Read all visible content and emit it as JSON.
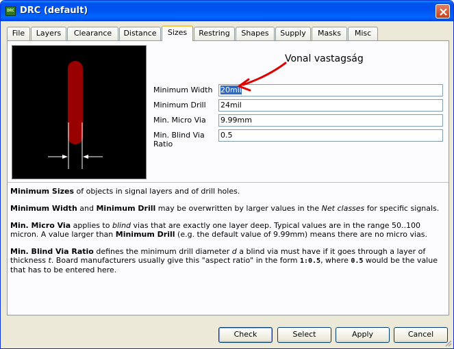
{
  "window": {
    "title": "DRC (default)",
    "app_icon_text": "DRC"
  },
  "tabs": [
    {
      "label": "File"
    },
    {
      "label": "Layers"
    },
    {
      "label": "Clearance"
    },
    {
      "label": "Distance"
    },
    {
      "label": "Sizes"
    },
    {
      "label": "Restring"
    },
    {
      "label": "Shapes"
    },
    {
      "label": "Supply"
    },
    {
      "label": "Masks"
    },
    {
      "label": "Misc"
    }
  ],
  "active_tab": "Sizes",
  "annotation": "Vonal vastagság",
  "fields": [
    {
      "label": "Minimum Width",
      "value": "20mil"
    },
    {
      "label": "Minimum Drill",
      "value": "24mil"
    },
    {
      "label": "Min. Micro Via",
      "value": "9.99mm"
    },
    {
      "label": "Min. Blind Via Ratio",
      "value": "0.5"
    }
  ],
  "help": {
    "p1": {
      "b1": "Minimum Sizes",
      "t1": " of objects in signal layers and of drill holes."
    },
    "p2": {
      "b1": "Minimum Width",
      "t1": " and ",
      "b2": "Minimum Drill",
      "t2": " may be overwritten by larger values in the ",
      "i1": "Net classes",
      "t3": " for specific signals."
    },
    "p3": {
      "b1": "Min. Micro Via",
      "t1": " applies to ",
      "i1": "blind",
      "t2": " vias that are exactly one layer deep. Typical values are in the range 50..100 micron. A value larger than ",
      "b2": "Minimum Drill",
      "t3": " (e.g. the default value of 9.99mm) means there are no micro vias."
    },
    "p4": {
      "b1": "Min. Blind Via Ratio",
      "t1": " defines the minimum drill diameter ",
      "i1": "d",
      "t2": " a blind via must have if it goes through a layer of thickness ",
      "i2": "t",
      "t3": ". Board manufacturers usually give this \"aspect ratio\" in the form ",
      "m1": "1:0.5",
      "t4": ", where ",
      "m2": "0.5",
      "t5": " would be the value that has to be entered here."
    }
  },
  "buttons": {
    "check": "Check",
    "select": "Select",
    "apply": "Apply",
    "cancel": "Cancel"
  },
  "colors": {
    "trace": "#990000",
    "arrow_annotation": "#e00000",
    "titlebar": "#0054e3"
  }
}
